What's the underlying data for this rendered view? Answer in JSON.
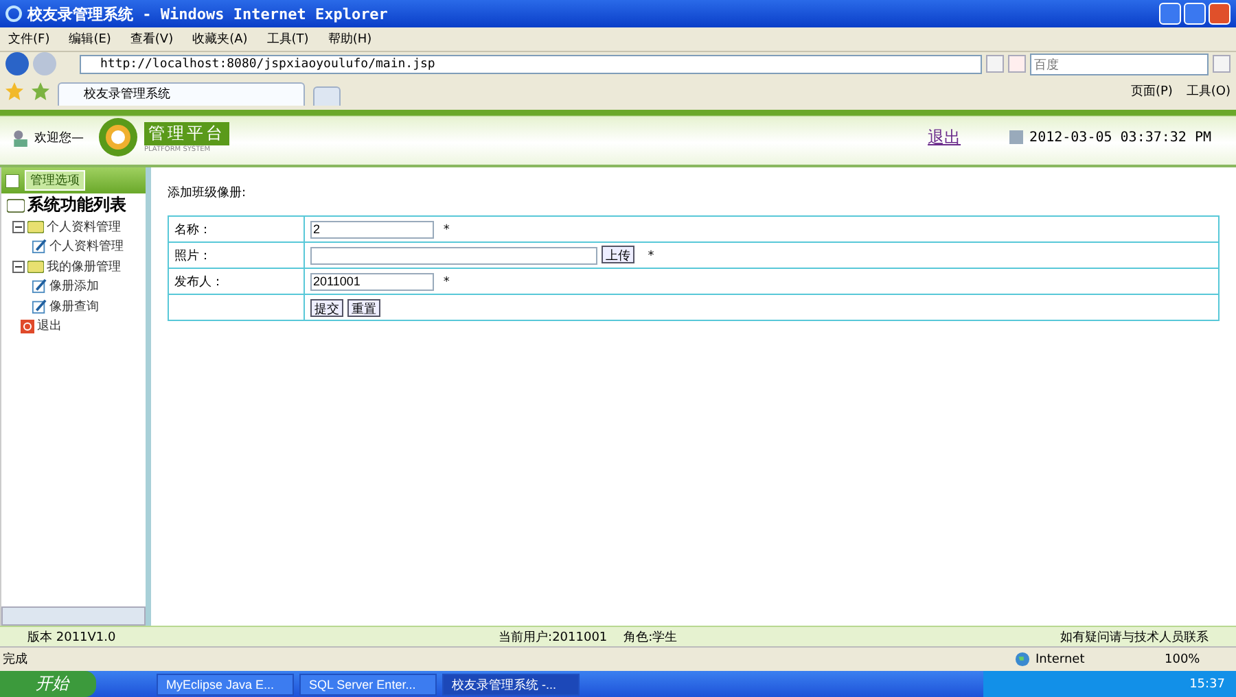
{
  "window": {
    "title": "校友录管理系统 - Windows Internet Explorer"
  },
  "menu": [
    "文件(F)",
    "编辑(E)",
    "查看(V)",
    "收藏夹(A)",
    "工具(T)",
    "帮助(H)"
  ],
  "address": {
    "value": "http://localhost:8080/jspxiaoyoulufo/main.jsp"
  },
  "search": {
    "placeholder": "百度"
  },
  "tab": {
    "label": "校友录管理系统",
    "selected": true
  },
  "toolbar": [
    "页面(P)",
    "工具(O)"
  ],
  "header": {
    "welcome": "欢迎您—",
    "logo": "管理平台",
    "logo_sub": "PLATFORM SYSTEM",
    "logout": "退出",
    "datetime": "2012-03-05 03:37:32 PM"
  },
  "sidebar": {
    "heading": "管理选项",
    "title": "系统功能列表",
    "items": [
      {
        "label": "个人资料管理",
        "expanded": true,
        "children": [
          {
            "label": "个人资料管理"
          }
        ]
      },
      {
        "label": "我的像册管理",
        "expanded": true,
        "children": [
          {
            "label": "像册添加"
          },
          {
            "label": "像册查询"
          }
        ]
      },
      {
        "label": "退出",
        "kind": "exit"
      }
    ]
  },
  "form": {
    "title": "添加班级像册:",
    "rows": [
      {
        "label": "名称：",
        "value": "2",
        "kind": "text",
        "required": "*"
      },
      {
        "label": "照片：",
        "kind": "upload",
        "button": "上传",
        "required": "*"
      },
      {
        "label": "发布人：",
        "value": "2011001",
        "kind": "text",
        "required": "*"
      }
    ],
    "buttons": [
      "提交",
      "重置"
    ]
  },
  "footer": {
    "version": "版本 2011V1.0",
    "user": "当前用户:2011001",
    "role": "角色:学生",
    "help": "如有疑问请与技术人员联系"
  },
  "status": {
    "text": "完成",
    "zone": "Internet",
    "zoom": "100%"
  },
  "taskbar": {
    "start": "开始",
    "tasks": [
      {
        "label": "MyEclipse Java E...",
        "selected": false
      },
      {
        "label": "SQL Server Enter...",
        "selected": false
      },
      {
        "label": "校友录管理系统 -...",
        "selected": true
      }
    ],
    "clock": "15:37"
  }
}
